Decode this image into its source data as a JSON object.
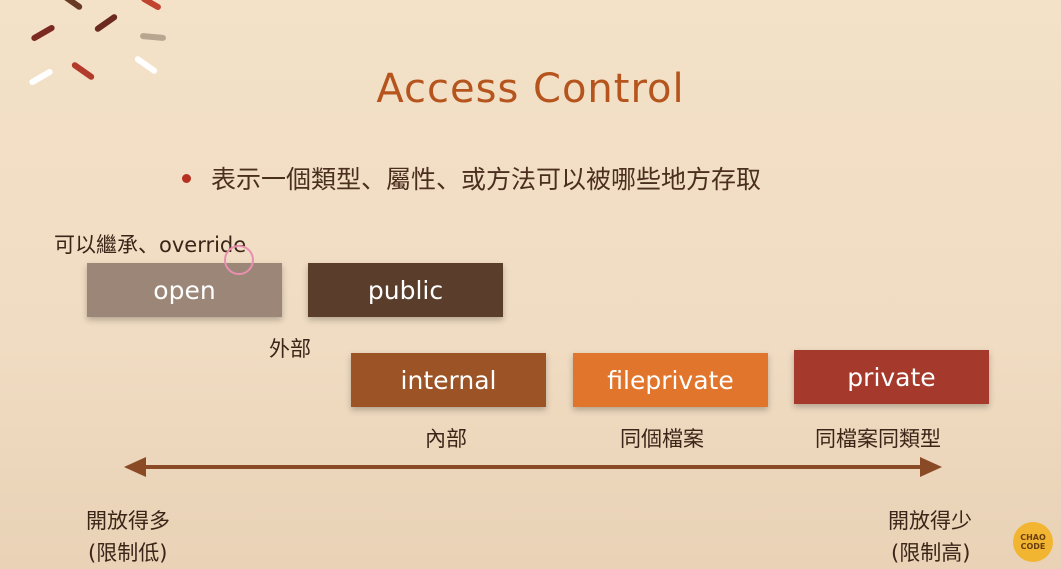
{
  "slide": {
    "title": "Access Control",
    "bullet": "表示一個類型、屬性、或方法可以被哪些地方存取"
  },
  "labels": {
    "override": "可以繼承、override",
    "outside": "外部",
    "inside": "內部",
    "same_file": "同個檔案",
    "same_file_type": "同檔案同類型",
    "more_open": "開放得多",
    "low_restrict": "(限制低)",
    "less_open": "開放得少",
    "high_restrict": "(限制高)"
  },
  "levels": [
    {
      "name": "open",
      "color": "#9b8677"
    },
    {
      "name": "public",
      "color": "#5a3e2b"
    },
    {
      "name": "internal",
      "color": "#9c5427"
    },
    {
      "name": "fileprivate",
      "color": "#e0752b"
    },
    {
      "name": "private",
      "color": "#a53a2c"
    }
  ],
  "logo": {
    "text": "CHAO CODE"
  }
}
